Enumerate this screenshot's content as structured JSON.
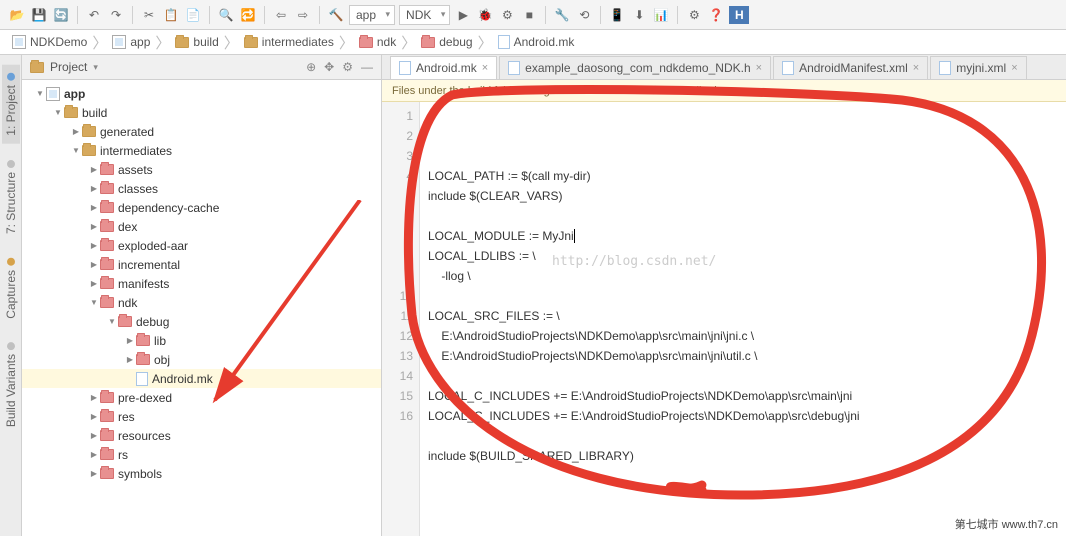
{
  "toolbar": {
    "run_config": "app",
    "ndk_config": "NDK"
  },
  "breadcrumb": [
    {
      "icon": "module",
      "label": "NDKDemo"
    },
    {
      "icon": "module",
      "label": "app"
    },
    {
      "icon": "folder",
      "label": "build"
    },
    {
      "icon": "folder",
      "label": "intermediates"
    },
    {
      "icon": "folder-red",
      "label": "ndk"
    },
    {
      "icon": "folder-red",
      "label": "debug"
    },
    {
      "icon": "file",
      "label": "Android.mk"
    }
  ],
  "left_tabs": [
    {
      "label": "1: Project",
      "color": "#6aa0d8",
      "active": true
    },
    {
      "label": "7: Structure",
      "color": "#c0c0c0",
      "active": false
    },
    {
      "label": "Captures",
      "color": "#d6a24a",
      "active": false
    },
    {
      "label": "Build Variants",
      "color": "#c0c0c0",
      "active": false
    }
  ],
  "project_panel": {
    "title": "Project"
  },
  "tree": [
    {
      "indent": 0,
      "arrow": "down",
      "icon": "module",
      "label": "app",
      "bold": true,
      "sel": false
    },
    {
      "indent": 1,
      "arrow": "down",
      "icon": "folder",
      "label": "build",
      "sel": false
    },
    {
      "indent": 2,
      "arrow": "right",
      "icon": "folder",
      "label": "generated",
      "sel": false
    },
    {
      "indent": 2,
      "arrow": "down",
      "icon": "folder",
      "label": "intermediates",
      "sel": false
    },
    {
      "indent": 3,
      "arrow": "right",
      "icon": "folder-red",
      "label": "assets",
      "sel": false
    },
    {
      "indent": 3,
      "arrow": "right",
      "icon": "folder-red",
      "label": "classes",
      "sel": false
    },
    {
      "indent": 3,
      "arrow": "right",
      "icon": "folder-red",
      "label": "dependency-cache",
      "sel": false
    },
    {
      "indent": 3,
      "arrow": "right",
      "icon": "folder-red",
      "label": "dex",
      "sel": false
    },
    {
      "indent": 3,
      "arrow": "right",
      "icon": "folder-red",
      "label": "exploded-aar",
      "sel": false
    },
    {
      "indent": 3,
      "arrow": "right",
      "icon": "folder-red",
      "label": "incremental",
      "sel": false
    },
    {
      "indent": 3,
      "arrow": "right",
      "icon": "folder-red",
      "label": "manifests",
      "sel": false
    },
    {
      "indent": 3,
      "arrow": "down",
      "icon": "folder-red",
      "label": "ndk",
      "sel": false
    },
    {
      "indent": 4,
      "arrow": "down",
      "icon": "folder-red",
      "label": "debug",
      "sel": false
    },
    {
      "indent": 5,
      "arrow": "right",
      "icon": "folder-red",
      "label": "lib",
      "sel": false
    },
    {
      "indent": 5,
      "arrow": "right",
      "icon": "folder-red",
      "label": "obj",
      "sel": false
    },
    {
      "indent": 5,
      "arrow": "none",
      "icon": "file",
      "label": "Android.mk",
      "sel": true
    },
    {
      "indent": 3,
      "arrow": "right",
      "icon": "folder-red",
      "label": "pre-dexed",
      "sel": false
    },
    {
      "indent": 3,
      "arrow": "right",
      "icon": "folder-red",
      "label": "res",
      "sel": false
    },
    {
      "indent": 3,
      "arrow": "right",
      "icon": "folder-red",
      "label": "resources",
      "sel": false
    },
    {
      "indent": 3,
      "arrow": "right",
      "icon": "folder-red",
      "label": "rs",
      "sel": false
    },
    {
      "indent": 3,
      "arrow": "right",
      "icon": "folder-red",
      "label": "symbols",
      "sel": false
    }
  ],
  "editor": {
    "tabs": [
      {
        "label": "Android.mk",
        "icon": "file",
        "active": true
      },
      {
        "label": "example_daosong_com_ndkdemo_NDK.h",
        "icon": "file",
        "active": false
      },
      {
        "label": "AndroidManifest.xml",
        "icon": "file",
        "active": false
      },
      {
        "label": "myjni.xml",
        "icon": "file",
        "active": false
      }
    ],
    "banner": "Files under the build folder are generated and should not be edited.",
    "watermark": "http://blog.csdn.net/",
    "lines": [
      "LOCAL_PATH := $(call my-dir)",
      "include $(CLEAR_VARS)",
      "",
      "LOCAL_MODULE := MyJni",
      "LOCAL_LDLIBS := \\",
      "    -llog \\",
      "",
      "LOCAL_SRC_FILES := \\",
      "    E:\\AndroidStudioProjects\\NDKDemo\\app\\src\\main\\jni\\jni.c \\",
      "    E:\\AndroidStudioProjects\\NDKDemo\\app\\src\\main\\jni\\util.c \\",
      "",
      "LOCAL_C_INCLUDES += E:\\AndroidStudioProjects\\NDKDemo\\app\\src\\main\\jni",
      "LOCAL_C_INCLUDES += E:\\AndroidStudioProjects\\NDKDemo\\app\\src\\debug\\jni",
      "",
      "include $(BUILD_SHARED_LIBRARY)",
      ""
    ]
  },
  "footer": "第七城市   www.th7.cn"
}
